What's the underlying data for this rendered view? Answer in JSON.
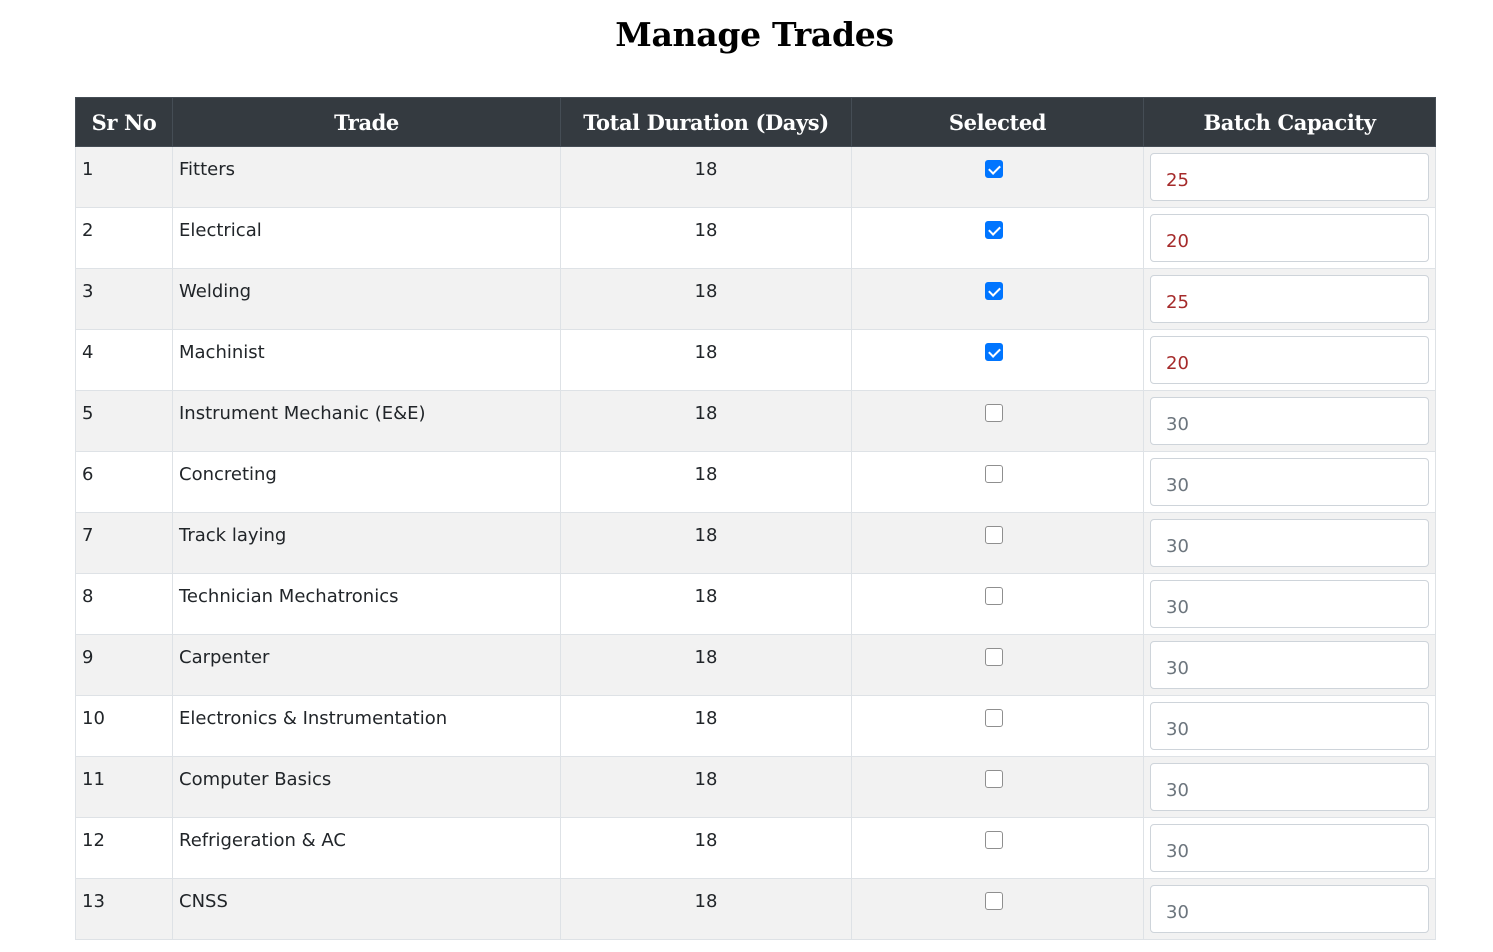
{
  "page": {
    "title": "Manage Trades"
  },
  "table": {
    "headers": [
      "Sr No",
      "Trade",
      "Total Duration (Days)",
      "Selected",
      "Batch Capacity"
    ],
    "rows": [
      {
        "sr": "1",
        "trade": "Fitters",
        "duration": "18",
        "selected": true,
        "capacity": "25"
      },
      {
        "sr": "2",
        "trade": "Electrical",
        "duration": "18",
        "selected": true,
        "capacity": "20"
      },
      {
        "sr": "3",
        "trade": "Welding",
        "duration": "18",
        "selected": true,
        "capacity": "25"
      },
      {
        "sr": "4",
        "trade": "Machinist",
        "duration": "18",
        "selected": true,
        "capacity": "20"
      },
      {
        "sr": "5",
        "trade": "Instrument Mechanic (E&E)",
        "duration": "18",
        "selected": false,
        "capacity": "30"
      },
      {
        "sr": "6",
        "trade": "Concreting",
        "duration": "18",
        "selected": false,
        "capacity": "30"
      },
      {
        "sr": "7",
        "trade": "Track laying",
        "duration": "18",
        "selected": false,
        "capacity": "30"
      },
      {
        "sr": "8",
        "trade": "Technician Mechatronics",
        "duration": "18",
        "selected": false,
        "capacity": "30"
      },
      {
        "sr": "9",
        "trade": "Carpenter",
        "duration": "18",
        "selected": false,
        "capacity": "30"
      },
      {
        "sr": "10",
        "trade": "Electronics & Instrumentation",
        "duration": "18",
        "selected": false,
        "capacity": "30"
      },
      {
        "sr": "11",
        "trade": "Computer Basics",
        "duration": "18",
        "selected": false,
        "capacity": "30"
      },
      {
        "sr": "12",
        "trade": "Refrigeration & AC",
        "duration": "18",
        "selected": false,
        "capacity": "30"
      },
      {
        "sr": "13",
        "trade": "CNSS",
        "duration": "18",
        "selected": false,
        "capacity": "30"
      }
    ]
  },
  "colors": {
    "header_bg": "#343a40",
    "checkbox_checked": "#0075ff",
    "active_capacity_text": "#a52a2a",
    "inactive_capacity_text": "#6c757d"
  }
}
